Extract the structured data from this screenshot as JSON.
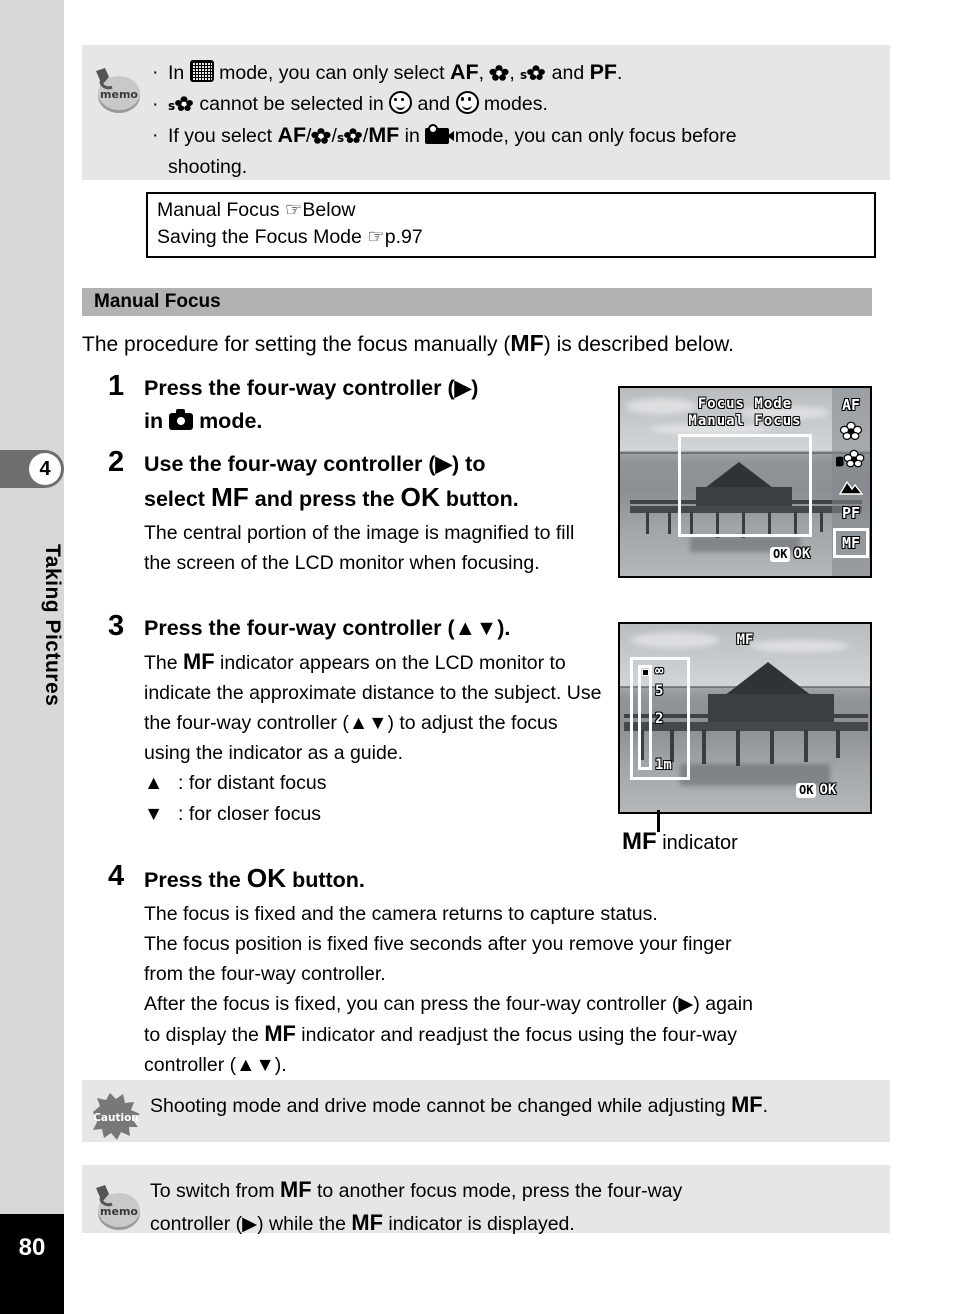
{
  "sidebar": {
    "chapter_number": "4",
    "chapter_title": "Taking Pictures",
    "page_number": "80"
  },
  "memo_top": {
    "icon": "memo-icon",
    "bullets": [
      {
        "pre": "In ",
        "icon1": "frame-composite-mode-icon",
        "mid": " mode, you can only select ",
        "sym1": "AF",
        "sep1": ", ",
        "icon2": "macro-icon",
        "sep2": ", ",
        "icon3": "super-macro-icon",
        "mid2": " and ",
        "sym2": "PF",
        "post": "."
      },
      {
        "icon1": "super-macro-icon",
        "pre": " cannot be selected in ",
        "icon2": "portrait-mode-icon",
        "mid": " and ",
        "icon3": "kids-mode-icon",
        "post": " modes."
      },
      {
        "pre": "If you select ",
        "sym1": "AF",
        "slash1": "/",
        "icon1": "macro-icon",
        "slash2": "/",
        "icon2": "super-macro-icon",
        "slash3": "/",
        "sym2": "MF",
        "mid": " in ",
        "icon3": "movie-mode-icon",
        "post": " mode, you can only focus before",
        "line2": "shooting."
      }
    ]
  },
  "reference_box": {
    "line1_text": "Manual Focus ",
    "line1_pointer": "☞",
    "line1_target": "Below",
    "line2_text": "Saving the Focus Mode ",
    "line2_pointer": "☞",
    "line2_target": "p.97"
  },
  "section": {
    "heading": "Manual Focus",
    "intro_pre": "The procedure for setting the focus manually (",
    "intro_sym": "MF",
    "intro_post": ") is described below."
  },
  "steps": [
    {
      "number": "1",
      "title_pre": "Press the four-way controller (",
      "title_arrow": "▶",
      "title_mid": ")",
      "title_line2_pre": "in ",
      "title_line2_icon": "capture-mode-icon",
      "title_line2_post": " mode.",
      "desc": ""
    },
    {
      "number": "2",
      "title_pre": "Use the four-way controller (",
      "title_arrow": "▶",
      "title_mid": ") to",
      "title_line2_pre": "select ",
      "title_line2_sym1": "MF",
      "title_line2_mid": " and press the ",
      "title_line2_sym2": "OK",
      "title_line2_post": " button.",
      "desc": "The central portion of the image is magnified to fill the screen of the LCD monitor when focusing."
    },
    {
      "number": "3",
      "title_pre": "Press the four-way controller (",
      "title_up": "▲",
      "title_down": "▼",
      "title_post": ").",
      "desc_pre": "The ",
      "desc_sym": "MF",
      "desc_post": " indicator appears on the LCD monitor to indicate the approximate distance to the subject. Use the four-way controller (",
      "desc_post2": ") to adjust the focus using the indicator as a guide.",
      "arrow_up_label": ":  for distant focus",
      "arrow_down_label": ":  for closer focus"
    },
    {
      "number": "4",
      "title_pre": "Press the ",
      "title_sym": "OK",
      "title_post": " button.",
      "desc_line1": "The focus is fixed and the camera returns to capture status.",
      "desc_line2a": "The focus position is fixed five seconds after you remove your finger",
      "desc_line2b": "from the four-way controller.",
      "desc_line3a": "After the focus is fixed, you can press the four-way controller (",
      "desc_line3b": ") again",
      "desc_line4a": "to display the ",
      "desc_line4sym": "MF",
      "desc_line4b": " indicator and readjust the focus using the four-way",
      "desc_line5a": "controller (",
      "desc_line5b": ")."
    }
  ],
  "lcd_screen_1": {
    "title_line1": "Focus Mode",
    "title_line2": "Manual Focus",
    "mode_items": [
      {
        "label": "AF",
        "icon": "autofocus-icon"
      },
      {
        "label": "",
        "icon": "macro-icon"
      },
      {
        "label": "",
        "icon": "super-macro-icon"
      },
      {
        "label": "",
        "icon": "infinity-landscape-icon"
      },
      {
        "label": "PF",
        "icon": "pan-focus-icon"
      },
      {
        "label": "MF",
        "icon": "manual-focus-icon"
      }
    ],
    "selected_mode": "MF",
    "ok_key": "OK",
    "ok_word": "OK"
  },
  "lcd_screen_2": {
    "mf_label": "MF",
    "scale_ticks": [
      "∞",
      "5",
      "2",
      "1m"
    ],
    "ok_key": "OK",
    "ok_word": "OK",
    "caption_sym": "MF",
    "caption_text": " indicator"
  },
  "caution_box": {
    "icon": "caution-icon",
    "text_pre": "Shooting mode and drive mode cannot be changed while adjusting ",
    "text_sym": "MF",
    "text_post": "."
  },
  "memo_bottom": {
    "icon": "memo-icon",
    "line1_pre": "To switch from ",
    "line1_sym": "MF",
    "line1_post": " to another focus mode, press the four-way",
    "line2_pre": "controller (",
    "line2_arrow": "▶",
    "line2_mid": ") while the ",
    "line2_sym": "MF",
    "line2_post": " indicator is displayed."
  },
  "colors": {
    "sidebar_gray": "#d8d8d8",
    "tab_dark": "#6e6e6e",
    "note_gray": "#e6e6e6",
    "heading_gray": "#b2b2b2",
    "page_block": "#000000"
  }
}
